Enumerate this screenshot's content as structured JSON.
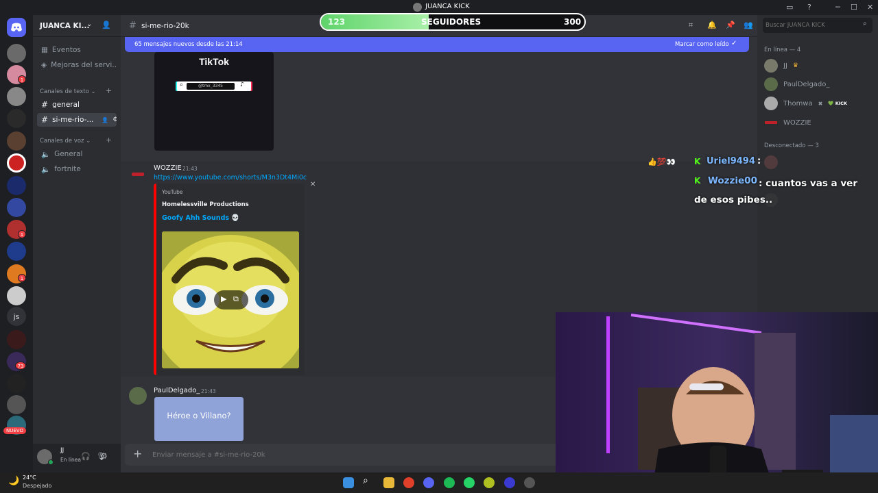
{
  "window": {
    "title": "JUANCA KICK"
  },
  "follow_bar": {
    "current": "123",
    "label": "SEGUIDORES",
    "goal": "300",
    "progress": 0.41
  },
  "guild_badges": [
    "1",
    "1",
    "1",
    "73"
  ],
  "guild_js": "js",
  "guild_new": "NUEVO",
  "server": {
    "name": "JUANCA KI...",
    "nav_items": [
      "Eventos",
      "Mejoras del servi..."
    ],
    "text_category": "Canales de texto",
    "text_channels": [
      "general",
      "si-me-rio-..."
    ],
    "voice_category": "Canales de voz",
    "voice_channels": [
      "General",
      "fortnite"
    ]
  },
  "user_panel": {
    "name": "JJ",
    "status": "En línea"
  },
  "channel": {
    "name": "si-me-rio-20k"
  },
  "new_messages": {
    "text": "65 mensajes nuevos desde las 21:14",
    "action": "Marcar como leído"
  },
  "tiktok_embed": {
    "brand": "TikTok",
    "handle": "@tmx_3345"
  },
  "messages": [
    {
      "author": "WOZZIE",
      "time": "21:43",
      "link": "https://www.youtube.com/shorts/M3n3Dt4Mi0c",
      "embed": {
        "provider": "YouTube",
        "author": "Homelessville Productions",
        "title": "Goofy Ahh Sounds 💀"
      }
    },
    {
      "author": "PaulDelgado_",
      "time": "21:43",
      "preview_text": "Héroe o Villano?"
    }
  ],
  "composer": {
    "placeholder": "Enviar mensaje a #si-me-rio-20k"
  },
  "search": {
    "placeholder": "Buscar JUANCA KICK"
  },
  "members": {
    "online_header": "En línea — 4",
    "online": [
      "JJ",
      "PaulDelgado_",
      "Thomwa",
      "WOZZIE"
    ],
    "kick_badge": "KICK",
    "offline_header": "Desconectado — 3"
  },
  "overlay_chat": {
    "emotes": "👍💯👀",
    "lines": [
      {
        "user": "Uriel9494",
        "text": ""
      },
      {
        "user": "Wozzie00",
        "text": "cuantos vas a ver de esos pibes.."
      }
    ]
  },
  "weather": {
    "temp": "24°C",
    "desc": "Despejado"
  },
  "colors": {
    "accent": "#5865f2",
    "link": "#00a8fc",
    "kick_green": "#53fc18",
    "embed_bar": "#ff0000"
  }
}
